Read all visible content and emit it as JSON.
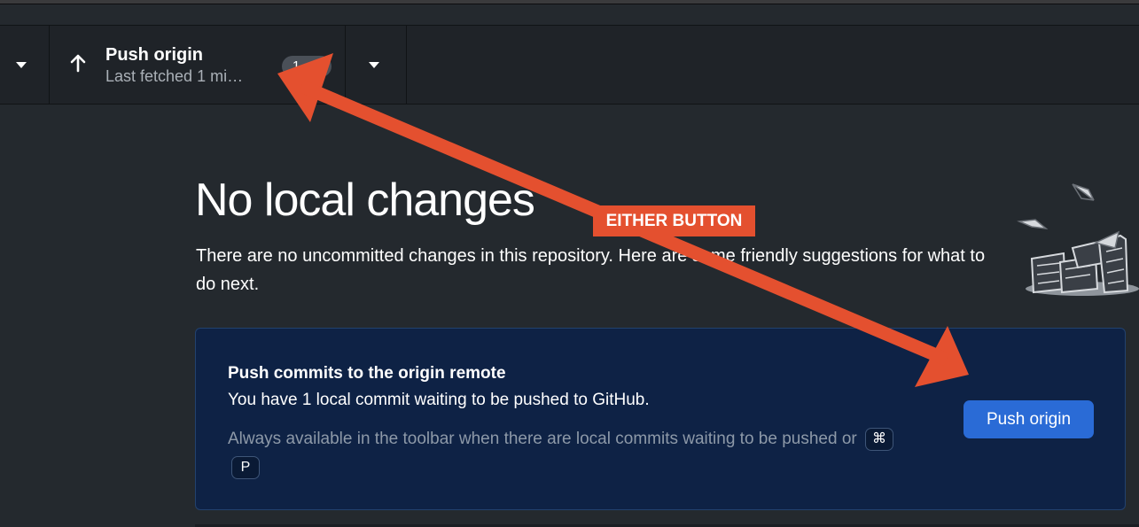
{
  "toolbar": {
    "push": {
      "title": "Push origin",
      "subtitle": "Last fetched 1 mi…",
      "badge": "1"
    }
  },
  "main": {
    "title": "No local changes",
    "description": "There are no uncommitted changes in this repository. Here are some friendly suggestions for what to do next."
  },
  "card": {
    "title": "Push commits to the origin remote",
    "description": "You have 1 local commit waiting to be pushed to GitHub.",
    "hint": "Always available in the toolbar when there are local commits waiting to be pushed or",
    "shortcut_keys": [
      "⌘",
      "P"
    ],
    "button_label": "Push origin"
  },
  "annotation": {
    "label": "EITHER BUTTON",
    "color": "#e4502f"
  },
  "colors": {
    "background": "#24292e",
    "toolbar": "#1f2328",
    "card_background": "#0e2245",
    "primary_button": "#2a6bd6"
  },
  "icons": {
    "push": "arrow-up-icon",
    "dropdown": "chevron-down-icon",
    "illustration": "paper-stack-icon"
  }
}
